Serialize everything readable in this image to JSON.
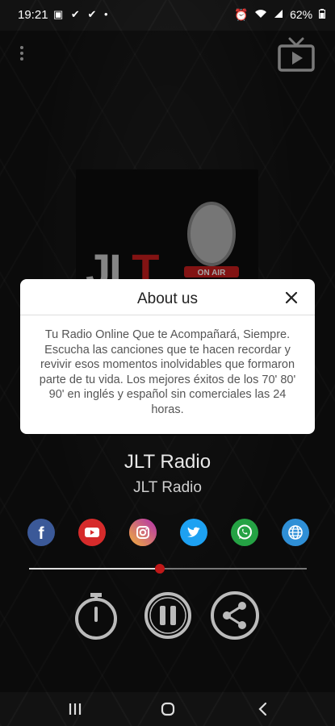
{
  "status_bar": {
    "time": "19:21",
    "left_icons": [
      "image-icon",
      "check-icon",
      "check-icon",
      "dot-icon"
    ],
    "right_icons": [
      "alarm-icon",
      "wifi-icon",
      "signal-icon"
    ],
    "battery": "62%"
  },
  "header": {
    "menu_icon": "kebab-menu-icon",
    "cast_icon": "tv-play-icon"
  },
  "cover": {
    "logo_text_gray": "JL",
    "logo_text_red": "T",
    "mic_badge": "ON AIR"
  },
  "dialog": {
    "title": "About us",
    "close_icon": "close-icon",
    "body": "Tu Radio Online Que te Acompañará, Siempre. Escucha las canciones que te hacen recordar y revivir esos momentos inolvidables que formaron parte de tu vida. Los mejores éxitos de los 70' 80' 90' en inglés y español sin comerciales las 24 horas."
  },
  "station": {
    "title": "JLT Radio",
    "subtitle": "JLT Radio"
  },
  "socials": [
    {
      "name": "facebook-icon",
      "color": "#3b5998"
    },
    {
      "name": "youtube-icon",
      "color": "#d62b2b"
    },
    {
      "name": "instagram-icon",
      "color": "#d6336c"
    },
    {
      "name": "twitter-icon",
      "color": "#1da1f2"
    },
    {
      "name": "whatsapp-icon",
      "color": "#25a244"
    },
    {
      "name": "web-icon",
      "color": "#2f8fd6"
    }
  ],
  "volume": {
    "level": 0.47
  },
  "controls": [
    "timer-icon",
    "pause-icon",
    "share-icon"
  ],
  "nav_bar": [
    "recents-icon",
    "home-icon",
    "back-icon"
  ],
  "colors": {
    "accent": "#c01818",
    "dialog_bg": "#ffffff"
  }
}
